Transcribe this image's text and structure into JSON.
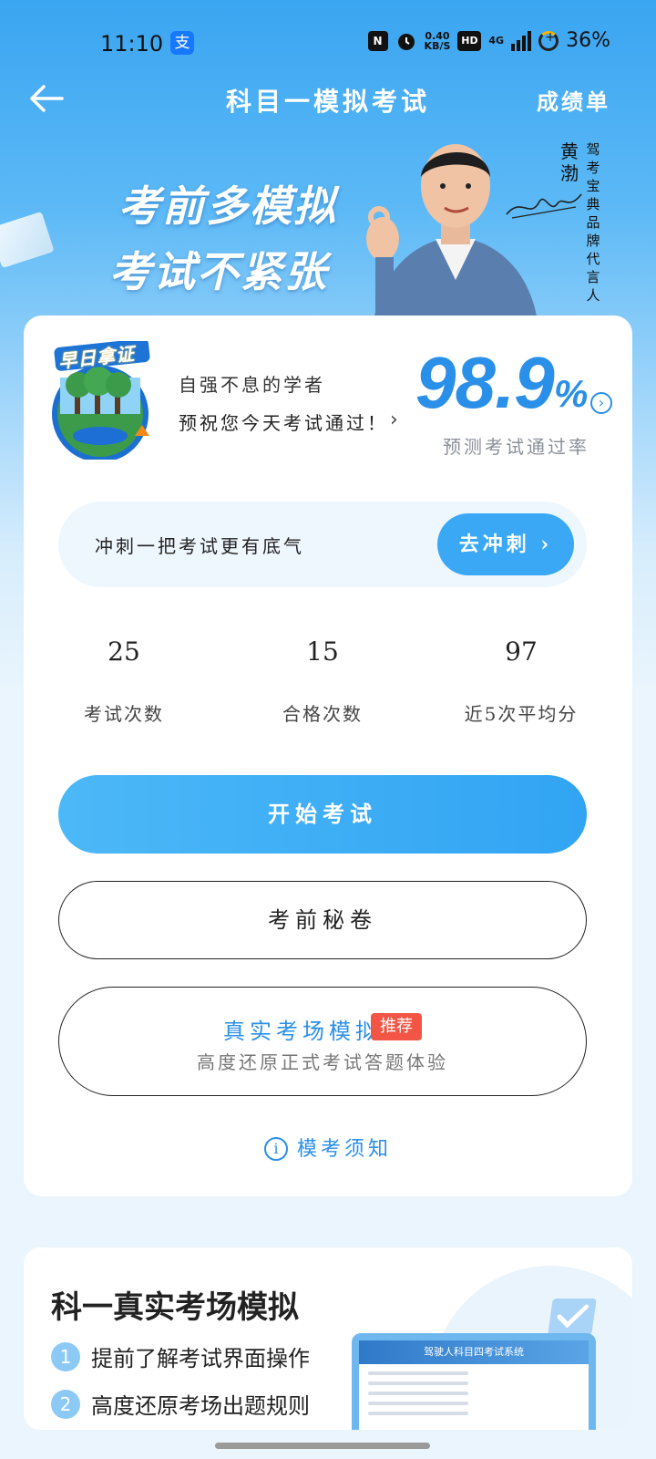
{
  "status_bar": {
    "time": "11:10",
    "alipay_glyph": "支",
    "nfc": "N",
    "net_speed_value": "0.40",
    "net_speed_unit": "KB/S",
    "hd": "HD",
    "network": "4G",
    "battery": "36%"
  },
  "nav": {
    "title": "科目一模拟考试",
    "report_label": "成绩单"
  },
  "banner": {
    "line1": "考前多模拟",
    "line2": "考试不紧张",
    "endorser_name": "黄渤",
    "endorser_title": "驾考宝典品牌代言人"
  },
  "summary": {
    "badge_text": "早日拿证",
    "greeting_title": "自强不息的学者",
    "greeting_message": "预祝您今天考试通过！",
    "pass_rate_value": "98.9",
    "pass_rate_unit": "%",
    "pass_rate_label": "预测考试通过率"
  },
  "sprint": {
    "text": "冲刺一把考试更有底气",
    "button_label": "去冲刺"
  },
  "stats": [
    {
      "value": "25",
      "label": "考试次数"
    },
    {
      "value": "15",
      "label": "合格次数"
    },
    {
      "value": "97",
      "label": "近5次平均分"
    }
  ],
  "buttons": {
    "start_exam": "开始考试",
    "secret_paper": "考前秘卷",
    "real_exam_title": "真实考场模拟",
    "real_exam_tag": "推荐",
    "real_exam_subtitle": "高度还原正式考试答题体验"
  },
  "notice_label": "模考须知",
  "real_exam_card": {
    "title": "科一真实考场模拟",
    "features": [
      {
        "num": "1",
        "text": "提前了解考试界面操作"
      },
      {
        "num": "2",
        "text": "高度还原考场出题规则"
      }
    ],
    "screen_title": "驾驶人科目四考试系统"
  },
  "colors": {
    "accent": "#2a8fe8",
    "button_blue": "#3aa8f5",
    "tag_red": "#f25545"
  }
}
